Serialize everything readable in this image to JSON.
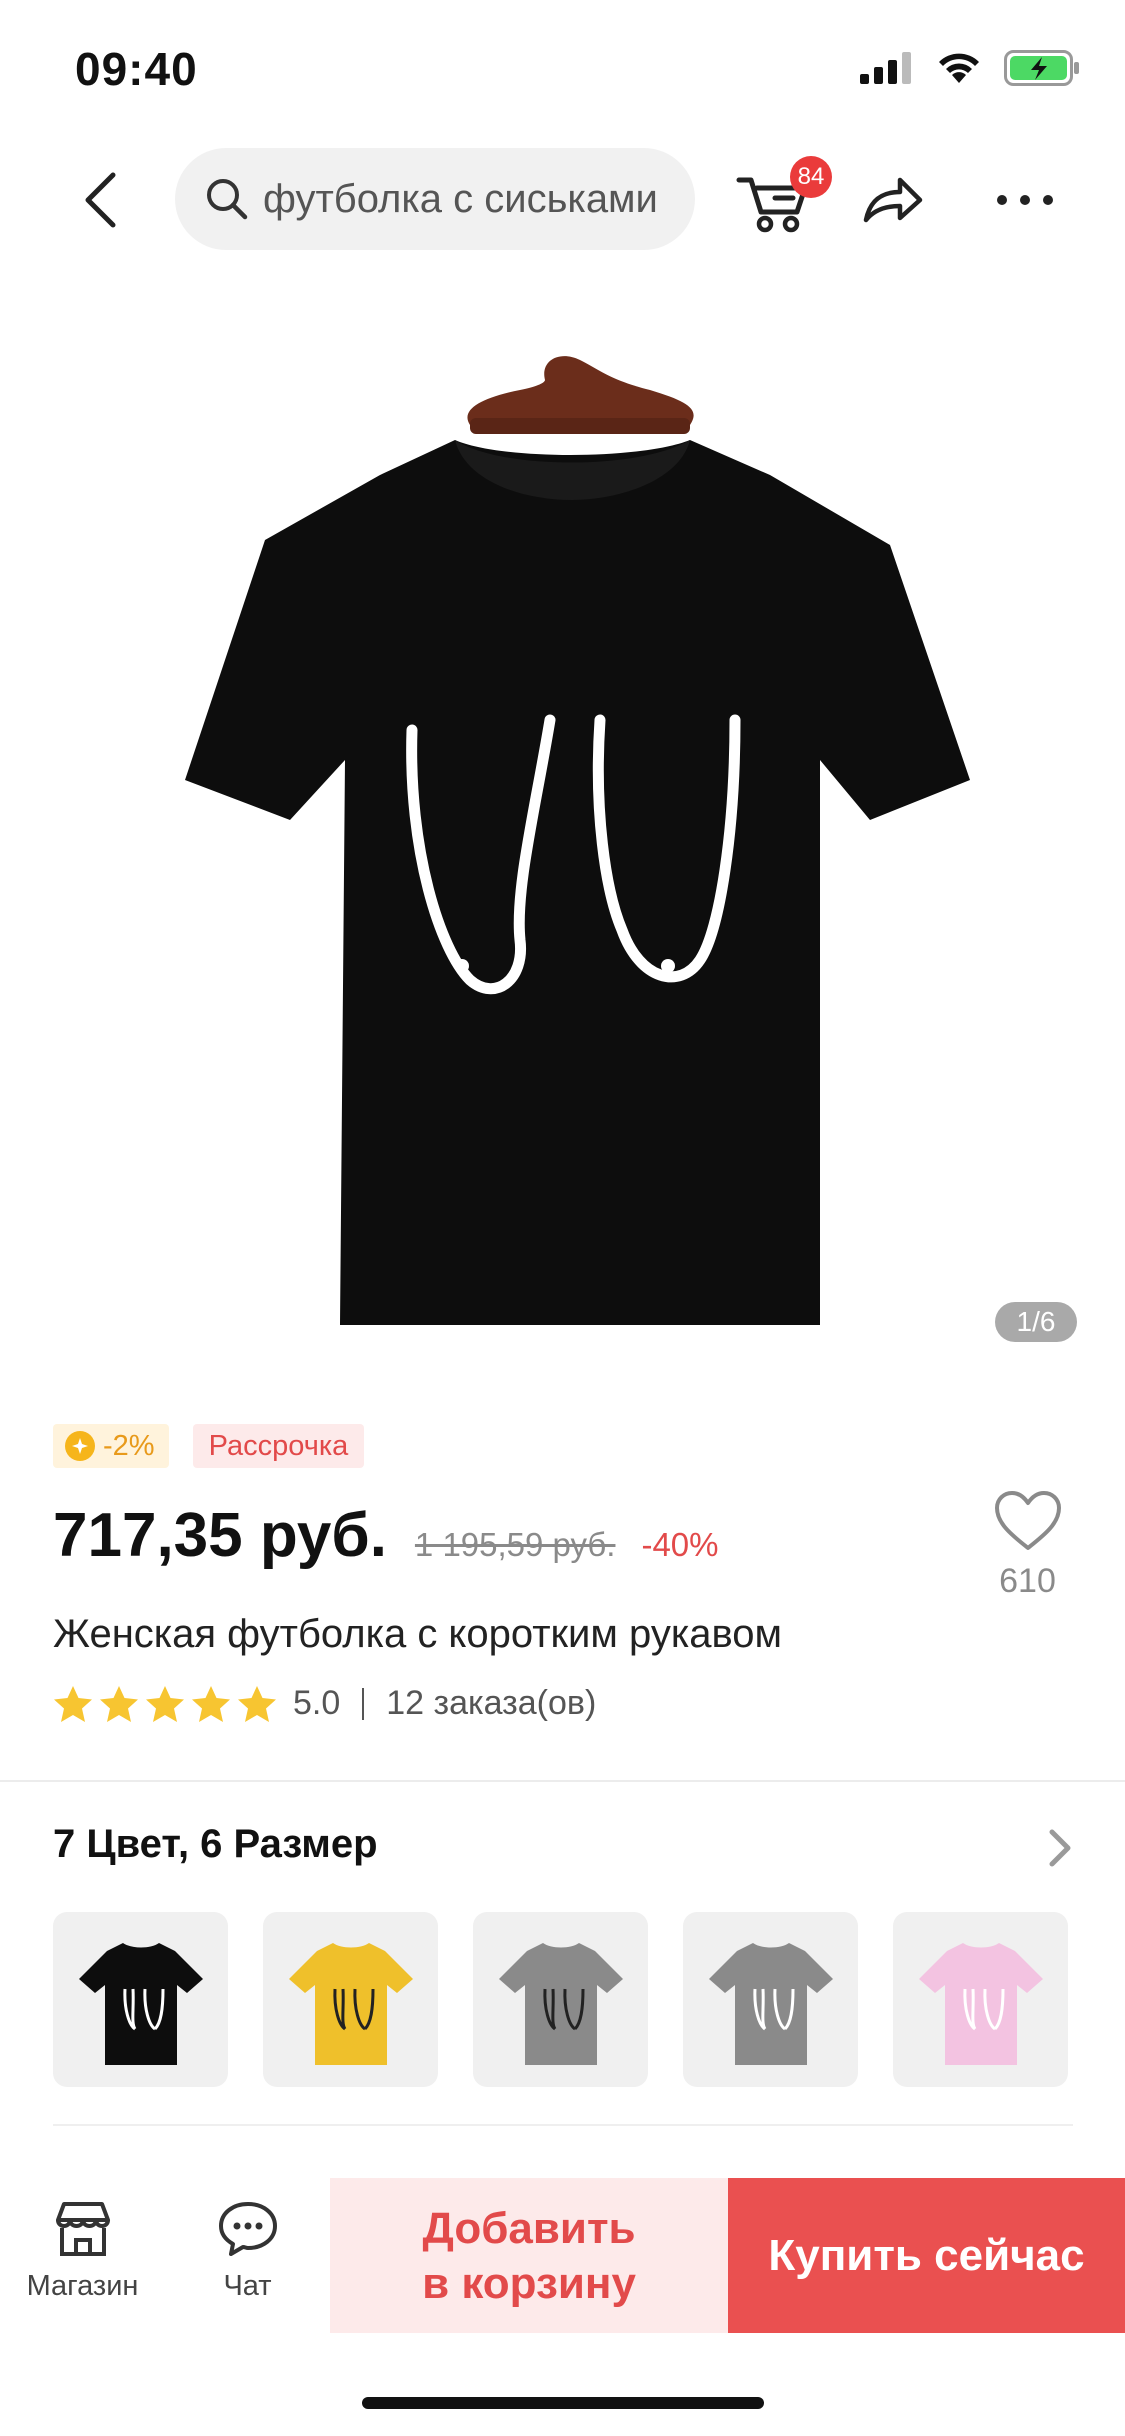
{
  "status": {
    "time": "09:40"
  },
  "search": {
    "query": "футболка с сиськами"
  },
  "header": {
    "cart_count": "84"
  },
  "gallery": {
    "indicator": "1/6"
  },
  "tags": {
    "coin_discount": "-2%",
    "installment": "Рассрочка"
  },
  "price": {
    "current": "717,35 руб.",
    "old": "1 195,59 руб.",
    "discount": "-40%"
  },
  "wishlist": {
    "count": "610"
  },
  "product": {
    "title": "Женская футболка с коротким рукавом"
  },
  "rating": {
    "value": "5.0",
    "stars": 5,
    "orders": "12 заказа(ов)"
  },
  "variants": {
    "header": "7 Цвет, 6 Размер",
    "swatches": [
      {
        "color": "#0d0d0d",
        "print": "#ffffff"
      },
      {
        "color": "#efc02b",
        "print": "#222222"
      },
      {
        "color": "#8a8a8a",
        "print": "#222222"
      },
      {
        "color": "#8a8a8a",
        "print": "#ffffff"
      },
      {
        "color": "#f3c3e1",
        "print": "#ffffff"
      }
    ]
  },
  "bottom": {
    "shop_label": "Магазин",
    "chat_label": "Чат",
    "add_to_cart_line1": "Добавить",
    "add_to_cart_line2": "в корзину",
    "buy_now": "Купить сейчас"
  },
  "colors": {
    "accent": "#ea5050",
    "accent_light": "#fdeaea",
    "coin": "#f6b51b"
  }
}
